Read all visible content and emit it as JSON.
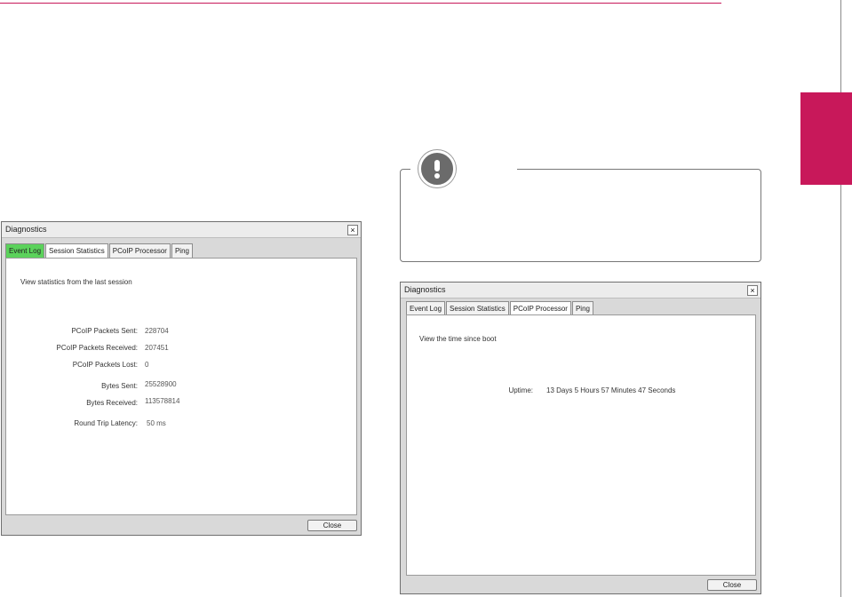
{
  "colors": {
    "accent": "#c8185a",
    "active_tab": "#5bd25b"
  },
  "left_dialog": {
    "title": "Diagnostics",
    "close_glyph": "×",
    "tabs": [
      "Event Log",
      "Session Statistics",
      "PCoIP Processor",
      "Ping"
    ],
    "intro": "View statistics from the last session",
    "stats": [
      {
        "label": "PCoIP Packets Sent:",
        "value": "228704"
      },
      {
        "label": "PCoIP Packets Received:",
        "value": "207451"
      },
      {
        "label": "PCoIP Packets Lost:",
        "value": "0"
      },
      {
        "label": "Bytes Sent:",
        "value": "25528900"
      },
      {
        "label": "Bytes Received:",
        "value": "113578814"
      },
      {
        "label": "Round Trip Latency:",
        "value": "50 ms"
      }
    ],
    "close_button": "Close"
  },
  "right_dialog": {
    "title": "Diagnostics",
    "close_glyph": "×",
    "tabs": [
      "Event Log",
      "Session Statistics",
      "PCoIP Processor",
      "Ping"
    ],
    "intro": "View the time since boot",
    "uptime_label": "Uptime:",
    "uptime_value": "13 Days 5 Hours 57 Minutes 47 Seconds",
    "close_button": "Close"
  },
  "note": {
    "icon": "exclamation-icon"
  }
}
